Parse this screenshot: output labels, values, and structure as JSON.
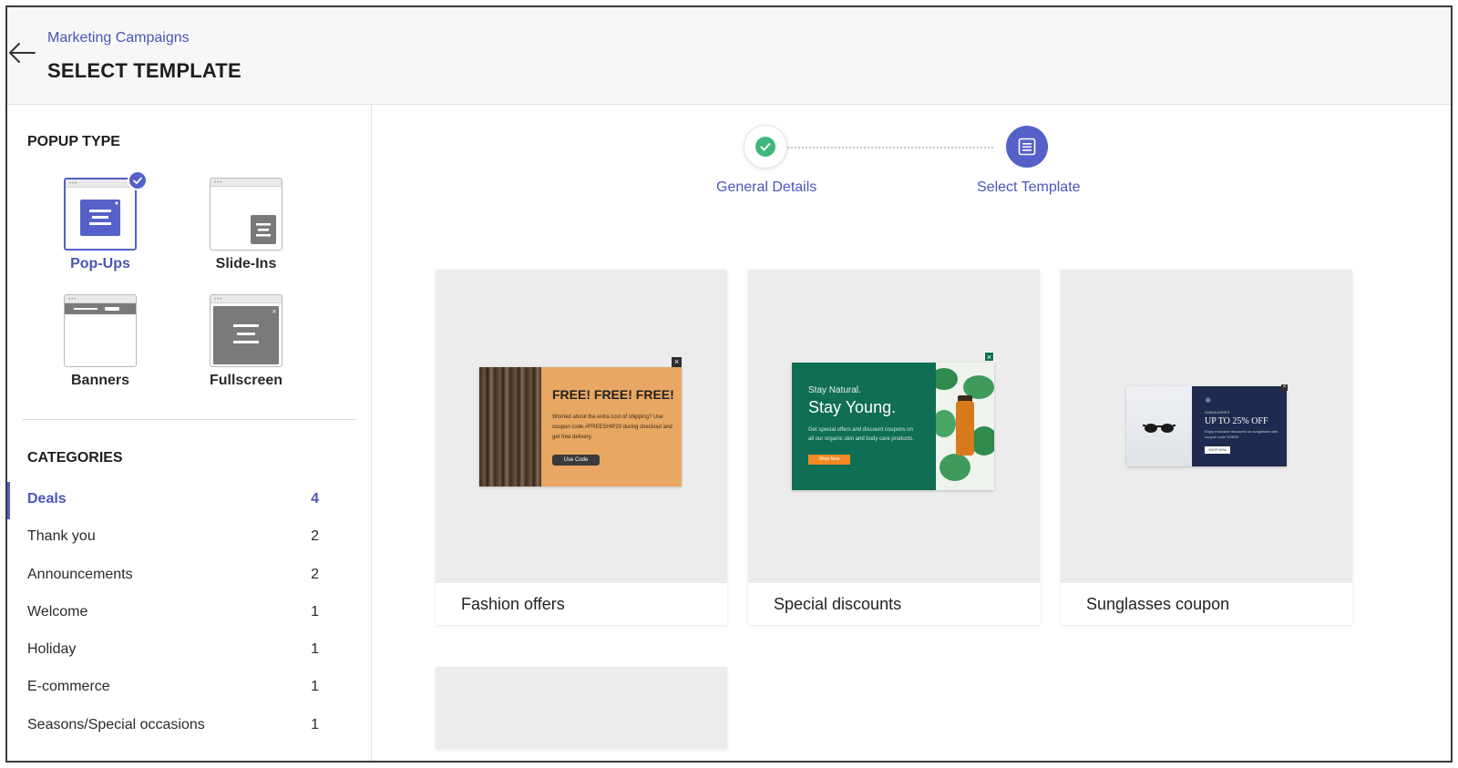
{
  "header": {
    "breadcrumb": "Marketing Campaigns",
    "title": "SELECT TEMPLATE"
  },
  "sidebar": {
    "popup_type_title": "POPUP TYPE",
    "popup_types": [
      {
        "label": "Pop-Ups",
        "selected": true
      },
      {
        "label": "Slide-Ins",
        "selected": false
      },
      {
        "label": "Banners",
        "selected": false
      },
      {
        "label": "Fullscreen",
        "selected": false
      }
    ],
    "categories_title": "CATEGORIES",
    "categories": [
      {
        "label": "Deals",
        "count": "4",
        "active": true
      },
      {
        "label": "Thank you",
        "count": "2"
      },
      {
        "label": "Announcements",
        "count": "2"
      },
      {
        "label": "Welcome",
        "count": "1"
      },
      {
        "label": "Holiday",
        "count": "1"
      },
      {
        "label": "E-commerce",
        "count": "1"
      },
      {
        "label": "Seasons/Special occasions",
        "count": "1"
      }
    ]
  },
  "stepper": {
    "steps": [
      {
        "label": "General Details",
        "status": "done"
      },
      {
        "label": "Select Template",
        "status": "active"
      }
    ]
  },
  "templates": [
    {
      "title": "Fashion offers",
      "popup": {
        "headline": "FREE! FREE! FREE!",
        "body": "Worried about the extra cost of shipping? Use coupon code #FREESHIP20 during checkout and get free delivery.",
        "cta": "Use Code"
      }
    },
    {
      "title": "Special discounts",
      "popup": {
        "kicker": "Stay Natural.",
        "headline": "Stay Young.",
        "body": "Get special offers and discount coupons on all our organic skin and body care products.",
        "cta": "Shop Now"
      }
    },
    {
      "title": "Sunglasses coupon",
      "popup": {
        "kicker": "SUNGLASSES",
        "headline": "UP TO 25% OFF",
        "body": "Enjoy exclusive discounts on sunglasses with coupon code SUN25",
        "cta": "SHOP NOW"
      }
    }
  ],
  "colors": {
    "accent": "#5560c8",
    "link": "#4a56b8",
    "success": "#3fb77b",
    "fashion_bg": "#e8a762",
    "special_bg": "#0f6e53",
    "sun_bg": "#1f2b4e"
  }
}
